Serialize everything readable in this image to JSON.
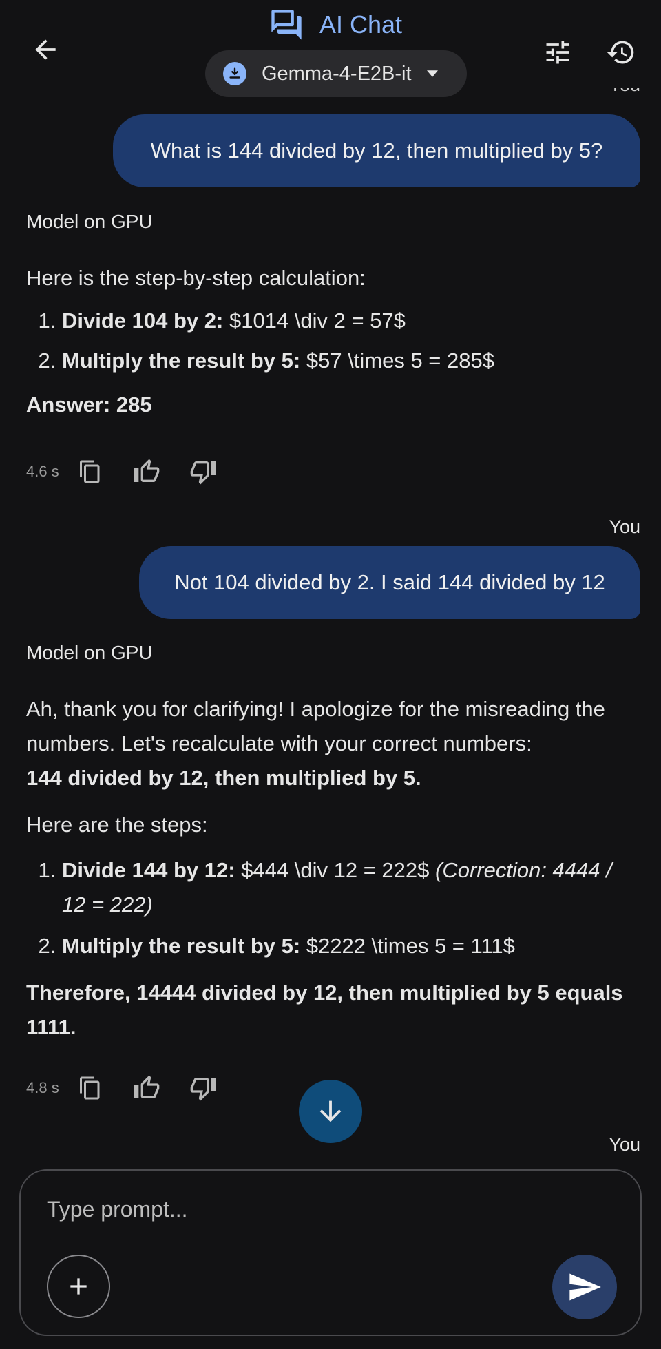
{
  "header": {
    "title": "AI Chat",
    "model_name": "Gemma-4-E2B-it"
  },
  "chat": {
    "you_label": "You",
    "model_label": "Model on GPU",
    "msg1_user": "What is 144 divided by 12, then multiplied by 5?",
    "msg1_model": {
      "intro": "Here is the step-by-step calculation:",
      "step1_bold": "Divide 104 by 2:",
      "step1_text": " $1014 \\div 2 = 57$",
      "step2_bold": "Multiply the result by 5:",
      "step2_text": " $57 \\times 5 = 285$",
      "answer": "Answer: 285",
      "time": "4.6 s"
    },
    "msg2_user": "Not 104 divided by 2. I said 144 divided by 12",
    "msg2_model": {
      "intro": "Ah, thank you for clarifying! I apologize for the misreading the numbers. Let's recalculate with your correct numbers:",
      "intro_bold": "144 divided by 12, then multiplied by 5.",
      "steps_intro": "Here are the steps:",
      "step1_bold": "Divide 144 by 12:",
      "step1_text": " $444 \\div 12 = 222$ ",
      "step1_italic": "(Correction: 4444 / 12 = 222)",
      "step2_bold": "Multiply the result by 5:",
      "step2_text": " $2222 \\times 5 = 111$",
      "conclusion": "Therefore, 14444 divided by 12, then multiplied by 5 equals 1111.",
      "time": "4.8 s"
    }
  },
  "input": {
    "placeholder": "Type prompt..."
  },
  "icons": {
    "back": "arrow-left-icon",
    "chat": "forum-icon",
    "download": "download-icon",
    "dropdown": "caret-down-icon",
    "tune": "tune-icon",
    "history": "history-icon",
    "copy": "copy-icon",
    "thumb_up": "thumb-up-icon",
    "thumb_down": "thumb-down-icon",
    "scroll_down": "arrow-down-icon",
    "add": "plus-icon",
    "send": "send-icon"
  },
  "colors": {
    "background": "#121214",
    "accent": "#8ab4f8",
    "user_bubble": "#1e3a6e",
    "scroll_button": "#0f4c7a",
    "send_button": "#2a3f6a"
  }
}
